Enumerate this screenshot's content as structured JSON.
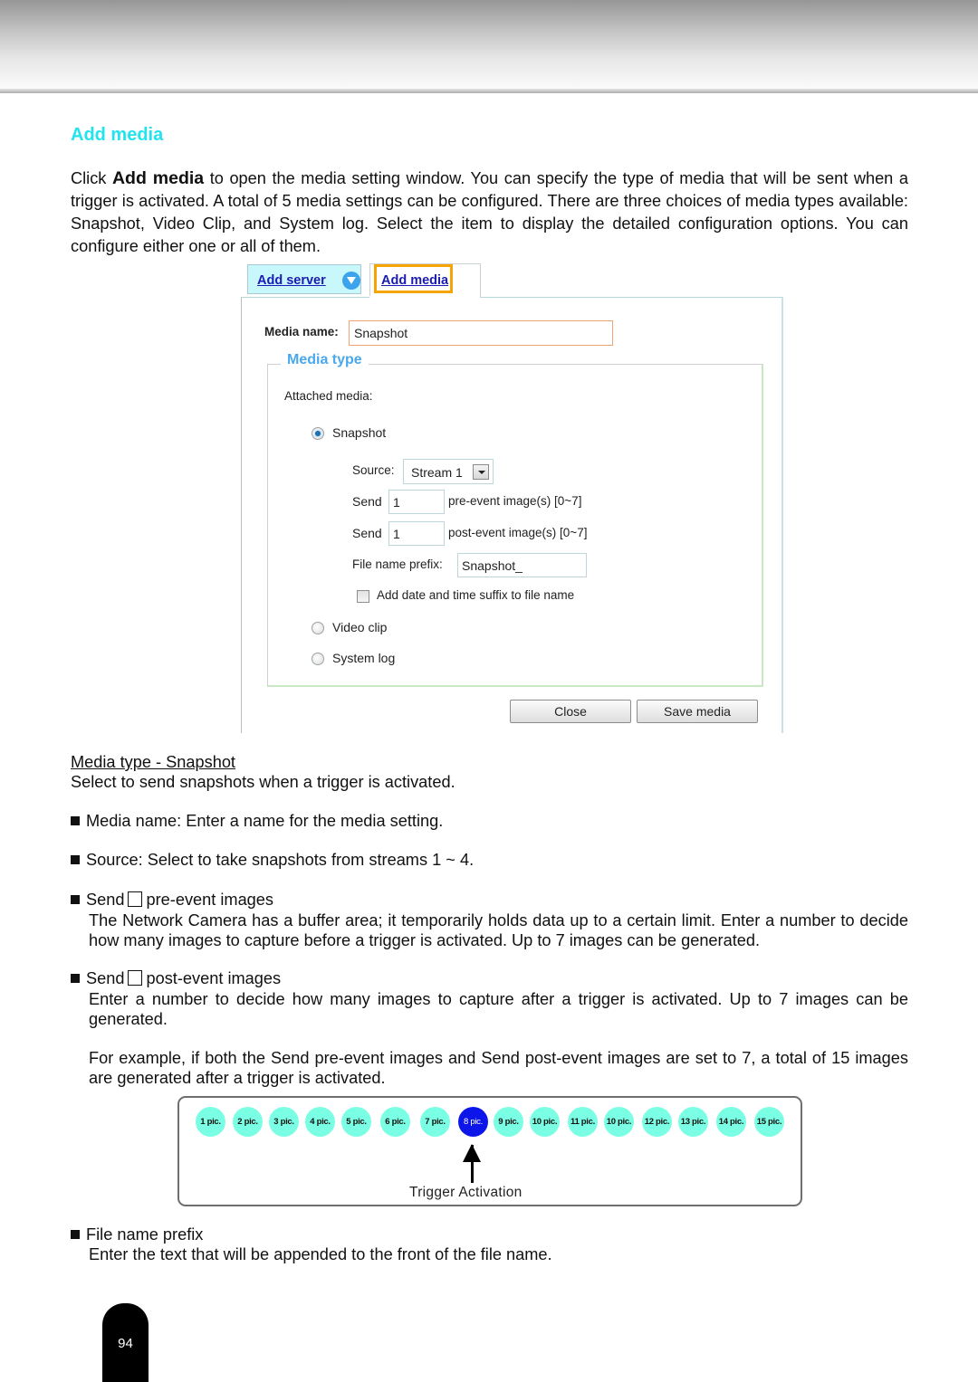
{
  "section": {
    "title": "Add media",
    "intro_pre": "Click ",
    "intro_bold": "Add media",
    "intro_post": " to open the media setting window. You can specify the type of media that will be sent when a trigger is activated. A total of 5 media settings can be configured. There are three choices of media types available: Snapshot, Video Clip, and System log. Select the item to display the detailed configuration options. You can configure either one or all of them."
  },
  "dialog": {
    "tabs": [
      {
        "label": "Add server",
        "icon": "chevron-down-icon"
      },
      {
        "label": "Add media",
        "highlighted": true
      }
    ],
    "media_name_label": "Media name:",
    "media_name_value": "Snapshot",
    "media_type_legend": "Media type",
    "attached_media_label": "Attached media:",
    "options": [
      {
        "label": "Snapshot",
        "selected": true
      },
      {
        "label": "Video clip",
        "selected": false
      },
      {
        "label": "System log",
        "selected": false
      }
    ],
    "source_label": "Source:",
    "source_value": "Stream 1",
    "send_label": "Send",
    "pre_event_value": "1",
    "pre_event_label": "pre-event image(s) [0~7]",
    "post_event_value": "1",
    "post_event_label": "post-event image(s) [0~7]",
    "prefix_label": "File name prefix:",
    "prefix_value": "Snapshot_",
    "suffix_checkbox_label": "Add date and time suffix to file name",
    "suffix_checked": false,
    "close_button": "Close",
    "save_button": "Save media"
  },
  "body": {
    "media_type_heading": "Media type - Snapshot ",
    "media_type_desc": "Select to send snapshots when a trigger is activated.",
    "bullet_media_name": "Media name: Enter a name for the media setting.",
    "bullet_source": "Source: Select to take snapshots from streams 1 ~ 4.",
    "bullet_pre_send": "Send",
    "bullet_pre_rest": "pre-event images",
    "pre_desc": "The Network Camera has a buffer area; it temporarily holds data up to a certain limit. Enter a number to decide how many images to capture before a trigger is activated. Up to 7 images can be generated.",
    "bullet_post_send": "Send",
    "bullet_post_rest": "post-event images",
    "post_desc": "Enter a number to decide how many images to capture after a trigger is activated. Up to 7 images can be generated.",
    "example": "For example, if both the Send pre-event images and Send post-event images are set to 7, a total of 15 images are generated after a trigger is activated.",
    "bullet_prefix": "File name prefix",
    "prefix_desc": "Enter the text that will be appended to the front of the file name."
  },
  "timeline": {
    "pics": [
      "1 pic.",
      "2 pic.",
      "3 pic.",
      "4 pic.",
      "5 pic.",
      "6 pic.",
      "7 pic.",
      "8 pic.",
      "9 pic.",
      "10 pic.",
      "11 pic.",
      "10 pic.",
      "12 pic.",
      "13 pic.",
      "14 pic.",
      "15 pic."
    ],
    "trigger_index": 7,
    "trigger_label": "Trigger Activation",
    "colors": {
      "pic": "#7affe4",
      "trigger": "#0d16e8"
    }
  },
  "page_number": "94"
}
